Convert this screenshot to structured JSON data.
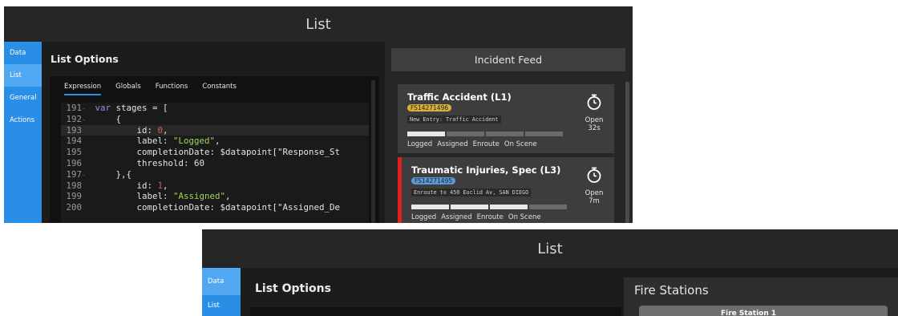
{
  "window1": {
    "title": "List",
    "sidebar": [
      {
        "label": "Data",
        "active": false
      },
      {
        "label": "List",
        "active": true
      },
      {
        "label": "General",
        "active": false
      },
      {
        "label": "Actions",
        "active": false
      }
    ],
    "panel_title": "List Options",
    "editor_tabs": [
      {
        "label": "Expression",
        "active": true
      },
      {
        "label": "Globals",
        "active": false
      },
      {
        "label": "Functions",
        "active": false
      },
      {
        "label": "Constants",
        "active": false
      }
    ],
    "code": [
      {
        "n": "191",
        "t": "var stages = [",
        "fold": true
      },
      {
        "n": "192",
        "t": "    {",
        "fold": true
      },
      {
        "n": "193",
        "t": "        id: 0,",
        "fold": false,
        "hl": true
      },
      {
        "n": "194",
        "t": "        label: \"Logged\",",
        "fold": false
      },
      {
        "n": "195",
        "t": "        completionDate: $datapoint[\"Response_St",
        "fold": false
      },
      {
        "n": "196",
        "t": "        threshold: 60",
        "fold": false
      },
      {
        "n": "197",
        "t": "    },{",
        "fold": true
      },
      {
        "n": "198",
        "t": "        id: 1,",
        "fold": false
      },
      {
        "n": "199",
        "t": "        label: \"Assigned\",",
        "fold": false
      },
      {
        "n": "200",
        "t": "        completionDate: $datapoint[\"Assigned_De",
        "fold": false
      }
    ],
    "feed": {
      "title": "Incident Feed",
      "stage_labels": [
        "Logged",
        "Assigned",
        "Enroute",
        "On Scene"
      ],
      "cards": [
        {
          "title": "Traffic Accident (L1)",
          "id": "FS14271496",
          "badge_color": "#d8b23a",
          "note": "New Entry: Traffic Accident",
          "status": "Open",
          "elapsed": "32s",
          "progress": [
            1,
            0,
            0,
            0
          ],
          "urgent": false
        },
        {
          "title": "Traumatic Injuries, Spec (L3)",
          "id": "FS14271495",
          "badge_color": "#5b9ad8",
          "note": "Enroute to 450 Euclid Av, SAN DIEGO",
          "status": "Open",
          "elapsed": "7m",
          "progress": [
            1,
            1,
            1,
            0
          ],
          "urgent": true
        }
      ]
    }
  },
  "window2": {
    "title": "List",
    "sidebar": [
      {
        "label": "Data",
        "active": true
      },
      {
        "label": "List",
        "active": false
      }
    ],
    "panel_title": "List Options",
    "stations_title": "Fire Stations",
    "station_row_partial": "Fire Station 1"
  },
  "colors": {
    "accent": "#2a8ee6",
    "urgent": "#e02020",
    "background": "#1c1c1c"
  }
}
